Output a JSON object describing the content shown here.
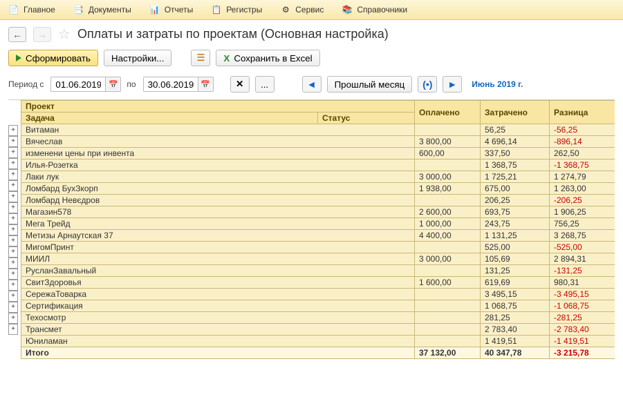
{
  "menu": {
    "items": [
      {
        "label": "Главное",
        "icon": "📄"
      },
      {
        "label": "Документы",
        "icon": "📑"
      },
      {
        "label": "Отчеты",
        "icon": "📊"
      },
      {
        "label": "Регистры",
        "icon": "📋"
      },
      {
        "label": "Сервис",
        "icon": "⚙"
      },
      {
        "label": "Справочники",
        "icon": "📚"
      }
    ]
  },
  "nav": {
    "back": "←",
    "fwd": "→",
    "star": "☆"
  },
  "title": "Оплаты и затраты по проектам (Основная настройка)",
  "toolbar": {
    "form": "Сформировать",
    "settings": "Настройки...",
    "save_excel": "Сохранить в Excel"
  },
  "period": {
    "label_from": "Период с",
    "date_from": "01.06.2019",
    "label_to": "по",
    "date_to": "30.06.2019",
    "clear": "✕",
    "more": "...",
    "prev_month": "Прошлый месяц",
    "display": "Июнь 2019 г."
  },
  "headers": {
    "project": "Проект",
    "task": "Задача",
    "status": "Статус",
    "paid": "Оплачено",
    "spent": "Затрачено",
    "diff": "Разница"
  },
  "rows": [
    {
      "name": "Витаман",
      "paid": "",
      "spent": "56,25",
      "diff": "-56,25",
      "neg": true
    },
    {
      "name": "Вячеслав",
      "paid": "3 800,00",
      "spent": "4 696,14",
      "diff": "-896,14",
      "neg": true
    },
    {
      "name": "изменени цены при инвента",
      "paid": "600,00",
      "spent": "337,50",
      "diff": "262,50",
      "neg": false
    },
    {
      "name": "Илья-Розетка",
      "paid": "",
      "spent": "1 368,75",
      "diff": "-1 368,75",
      "neg": true
    },
    {
      "name": "Лаки лук",
      "paid": "3 000,00",
      "spent": "1 725,21",
      "diff": "1 274,79",
      "neg": false
    },
    {
      "name": "Ломбард БухЗкорп",
      "paid": "1 938,00",
      "spent": "675,00",
      "diff": "1 263,00",
      "neg": false
    },
    {
      "name": "Ломбард Невєдров",
      "paid": "",
      "spent": "206,25",
      "diff": "-206,25",
      "neg": true
    },
    {
      "name": "Магазин578",
      "paid": "2 600,00",
      "spent": "693,75",
      "diff": "1 906,25",
      "neg": false
    },
    {
      "name": "Мега Трейд",
      "paid": "1 000,00",
      "spent": "243,75",
      "diff": "756,25",
      "neg": false
    },
    {
      "name": "Метизы Арнаутская 37",
      "paid": "4 400,00",
      "spent": "1 131,25",
      "diff": "3 268,75",
      "neg": false
    },
    {
      "name": "МигомПринт",
      "paid": "",
      "spent": "525,00",
      "diff": "-525,00",
      "neg": true
    },
    {
      "name": "МИИЛ",
      "paid": "3 000,00",
      "spent": "105,69",
      "diff": "2 894,31",
      "neg": false
    },
    {
      "name": "РусланЗавальный",
      "paid": "",
      "spent": "131,25",
      "diff": "-131,25",
      "neg": true
    },
    {
      "name": "СвитЗдоровья",
      "paid": "1 600,00",
      "spent": "619,69",
      "diff": "980,31",
      "neg": false
    },
    {
      "name": "СережаТоварка",
      "paid": "",
      "spent": "3 495,15",
      "diff": "-3 495,15",
      "neg": true
    },
    {
      "name": "Сертификация",
      "paid": "",
      "spent": "1 068,75",
      "diff": "-1 068,75",
      "neg": true
    },
    {
      "name": "Техосмотр",
      "paid": "",
      "spent": "281,25",
      "diff": "-281,25",
      "neg": true
    },
    {
      "name": "Трансмет",
      "paid": "",
      "spent": "2 783,40",
      "diff": "-2 783,40",
      "neg": true
    },
    {
      "name": "Юниламан",
      "paid": "",
      "spent": "1 419,51",
      "diff": "-1 419,51",
      "neg": true
    }
  ],
  "total": {
    "name": "Итого",
    "paid": "37 132,00",
    "spent": "40 347,78",
    "diff": "-3 215,78",
    "neg": true
  }
}
